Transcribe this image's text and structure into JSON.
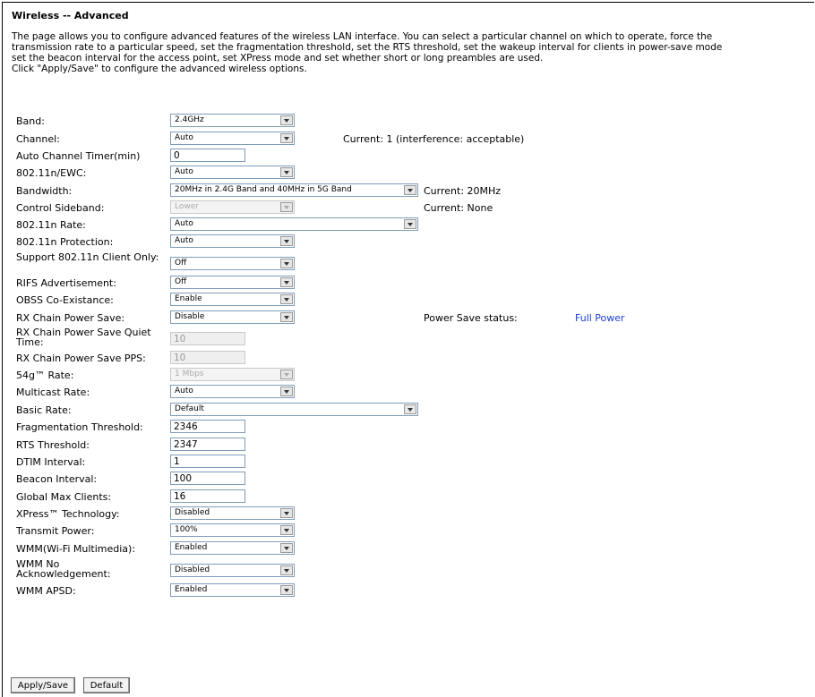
{
  "page": {
    "title": "Wireless -- Advanced",
    "description": [
      "The page allows you to configure advanced features of the wireless LAN interface. You can select a particular channel on which to operate, force the",
      "transmission rate to a particular speed, set the fragmentation threshold, set the RTS threshold, set the wakeup interval for clients in power-save mode",
      "set the beacon interval for the access point, set XPress mode and set whether short or long preambles are used.",
      "Click \"Apply/Save\" to configure the advanced wireless options."
    ]
  },
  "fields": {
    "band": {
      "label": "Band:",
      "value": "2.4GHz"
    },
    "channel": {
      "label": "Channel:",
      "value": "Auto",
      "current": "Current: 1 (interference: acceptable)"
    },
    "auto_channel_timer": {
      "label": "Auto Channel Timer(min)",
      "value": "0"
    },
    "ewc": {
      "label": "802.11n/EWC:",
      "value": "Auto"
    },
    "bandwidth": {
      "label": "Bandwidth:",
      "value": "20MHz in 2.4G Band and 40MHz in 5G Band",
      "current": "Current: 20MHz"
    },
    "control_sideband": {
      "label": "Control Sideband:",
      "value": "Lower",
      "current": "Current: None"
    },
    "n_rate": {
      "label": "802.11n Rate:",
      "value": "Auto"
    },
    "n_protection": {
      "label": "802.11n Protection:",
      "value": "Auto"
    },
    "n_client_only": {
      "label": "Support 802.11n Client Only:",
      "value": "Off"
    },
    "rifs": {
      "label": "RIFS Advertisement:",
      "value": "Off"
    },
    "obss": {
      "label": "OBSS Co-Existance:",
      "value": "Enable"
    },
    "rx_chain_ps": {
      "label": "RX Chain Power Save:",
      "value": "Disable",
      "status_label": "Power Save status:",
      "status_value": "Full Power"
    },
    "rx_chain_quiet": {
      "label": "RX Chain Power Save Quiet Time:",
      "value": "10"
    },
    "rx_chain_pps": {
      "label": "RX Chain Power Save PPS:",
      "value": "10"
    },
    "s54g_rate": {
      "label": "54g™ Rate:",
      "value": "1 Mbps"
    },
    "multicast_rate": {
      "label": "Multicast Rate:",
      "value": "Auto"
    },
    "basic_rate": {
      "label": "Basic Rate:",
      "value": "Default"
    },
    "frag_threshold": {
      "label": "Fragmentation Threshold:",
      "value": "2346"
    },
    "rts_threshold": {
      "label": "RTS Threshold:",
      "value": "2347"
    },
    "dtim": {
      "label": "DTIM Interval:",
      "value": "1"
    },
    "beacon": {
      "label": "Beacon Interval:",
      "value": "100"
    },
    "max_clients": {
      "label": "Global Max Clients:",
      "value": "16"
    },
    "xpress": {
      "label": "XPress™ Technology:",
      "value": "Disabled"
    },
    "tx_power": {
      "label": "Transmit Power:",
      "value": "100%"
    },
    "wmm": {
      "label": "WMM(Wi-Fi Multimedia):",
      "value": "Enabled"
    },
    "wmm_noack": {
      "label": "WMM No Acknowledgement:",
      "value": "Disabled"
    },
    "wmm_apsd": {
      "label": "WMM APSD:",
      "value": "Enabled"
    }
  },
  "buttons": {
    "apply": "Apply/Save",
    "default": "Default"
  },
  "colors": {
    "link": "#1e3fd6",
    "select_border": "#7f9db9"
  }
}
